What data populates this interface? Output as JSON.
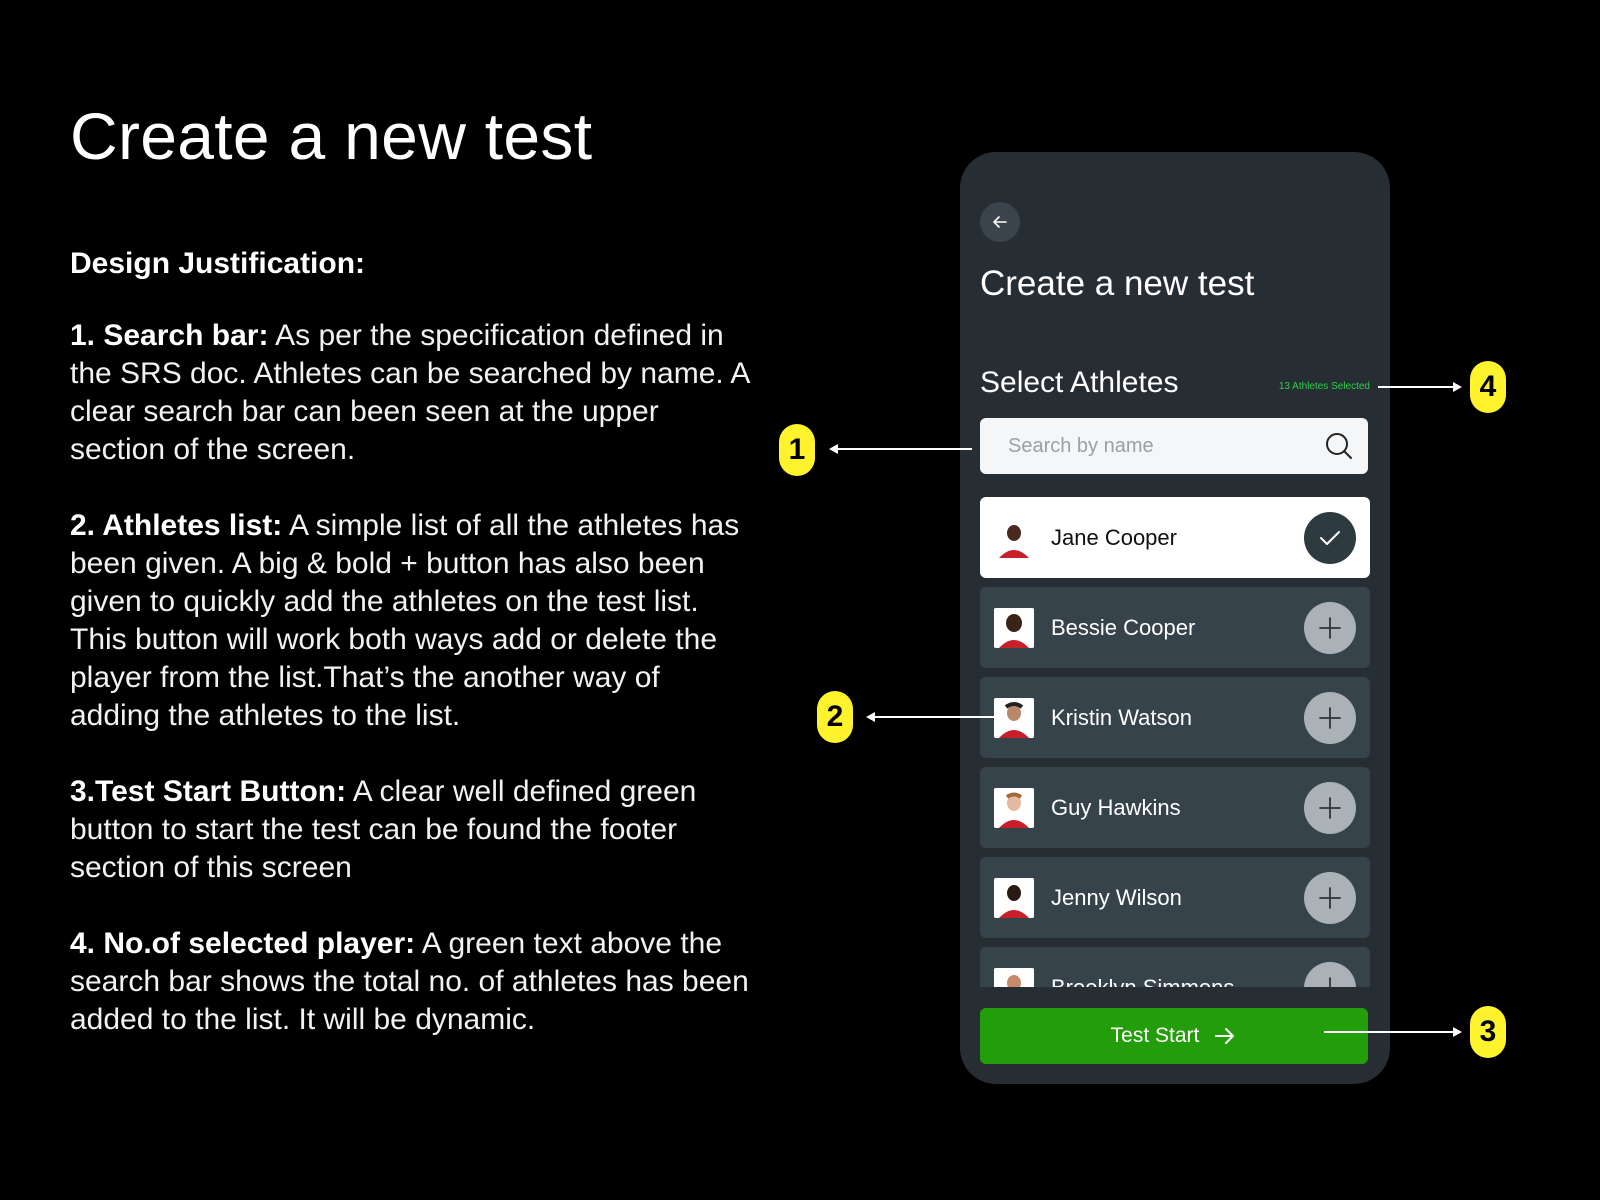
{
  "slide": {
    "title": "Create a new test",
    "justification_heading": "Design Justification:",
    "points": [
      {
        "label": "1. Search bar:",
        "text": " As per the specification defined in the SRS doc. Athletes can be searched by name. A clear search bar can been seen at the upper section of the screen."
      },
      {
        "label": "2. Athletes list:",
        "text": " A simple list of all the athletes has been given. A big & bold + button has also been given to quickly add the athletes on the test list. This button will work both ways add or delete the player from the list.That’s the another way of adding the athletes to the list."
      },
      {
        "label": "3.Test Start Button:",
        "text": " A clear well defined green button to start the test can be found the footer section of this screen"
      },
      {
        "label": "4. No.of selected player:",
        "text": " A green text above the search bar shows the total no. of athletes has been added to the list. It will be dynamic."
      }
    ]
  },
  "app": {
    "title": "Create a new test",
    "section_title": "Select Athletes",
    "selected_count": "13 Athletes Selected",
    "search": {
      "placeholder": "Search by name",
      "value": ""
    },
    "athletes": [
      {
        "name": "Jane Cooper",
        "selected": true,
        "icon": "check-icon"
      },
      {
        "name": "Bessie Cooper",
        "selected": false,
        "icon": "plus-icon"
      },
      {
        "name": "Kristin Watson",
        "selected": false,
        "icon": "plus-icon"
      },
      {
        "name": "Guy Hawkins",
        "selected": false,
        "icon": "plus-icon"
      },
      {
        "name": "Jenny Wilson",
        "selected": false,
        "icon": "plus-icon"
      },
      {
        "name": "Brooklyn Simmons",
        "selected": false,
        "icon": "plus-icon"
      }
    ],
    "start_button": "Test Start",
    "colors": {
      "accent_green": "#249d0b",
      "count_green": "#2fd04b",
      "badge_yellow": "#fff32e",
      "phone_bg": "#262d33"
    }
  },
  "annotations": {
    "badge1": "1",
    "badge2": "2",
    "badge3": "3",
    "badge4": "4"
  }
}
